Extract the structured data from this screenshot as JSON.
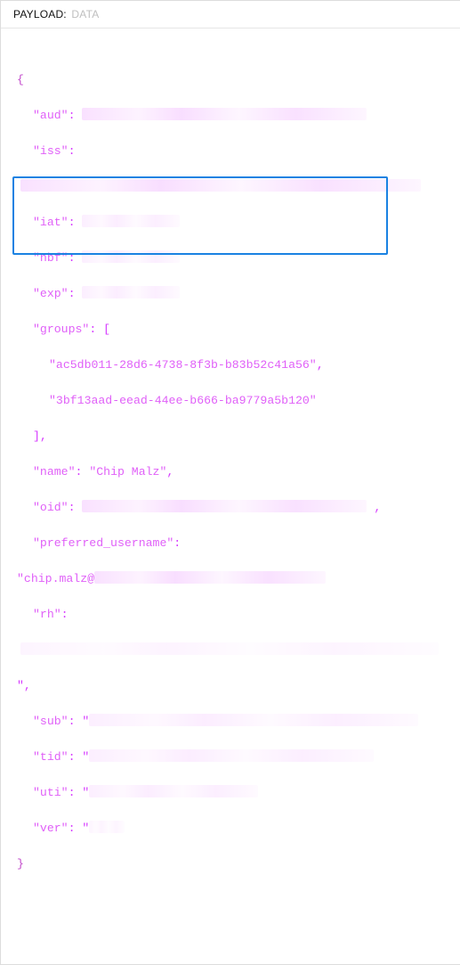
{
  "header": {
    "label": "PAYLOAD:",
    "sub": "DATA"
  },
  "json": {
    "open_brace": "{",
    "close_brace": "}",
    "aud_key": "\"aud\"",
    "iss_key": "\"iss\"",
    "iat_key": "\"iat\"",
    "nbf_key": "\"nbf\"",
    "exp_key": "\"exp\"",
    "groups_key": "\"groups\"",
    "groups_open": "[",
    "groups_val1": "\"ac5db011-28d6-4738-8f3b-b83b52c41a56\"",
    "groups_val2": "\"3bf13aad-eead-44ee-b666-ba9779a5b120\"",
    "groups_close": "],",
    "name_key": "\"name\"",
    "name_val": "\"Chip Malz\"",
    "oid_key": "\"oid\"",
    "pref_key": "\"preferred_username\"",
    "pref_prefix": "\"chip.malz@",
    "rh_key": "\"rh\"",
    "sub_key": "\"sub\"",
    "tid_key": "\"tid\"",
    "uti_key": "\"uti\"",
    "ver_key": "\"ver\"",
    "colon": ":",
    "comma": ",",
    "quote": "\"",
    "quote_comma": "\","
  }
}
